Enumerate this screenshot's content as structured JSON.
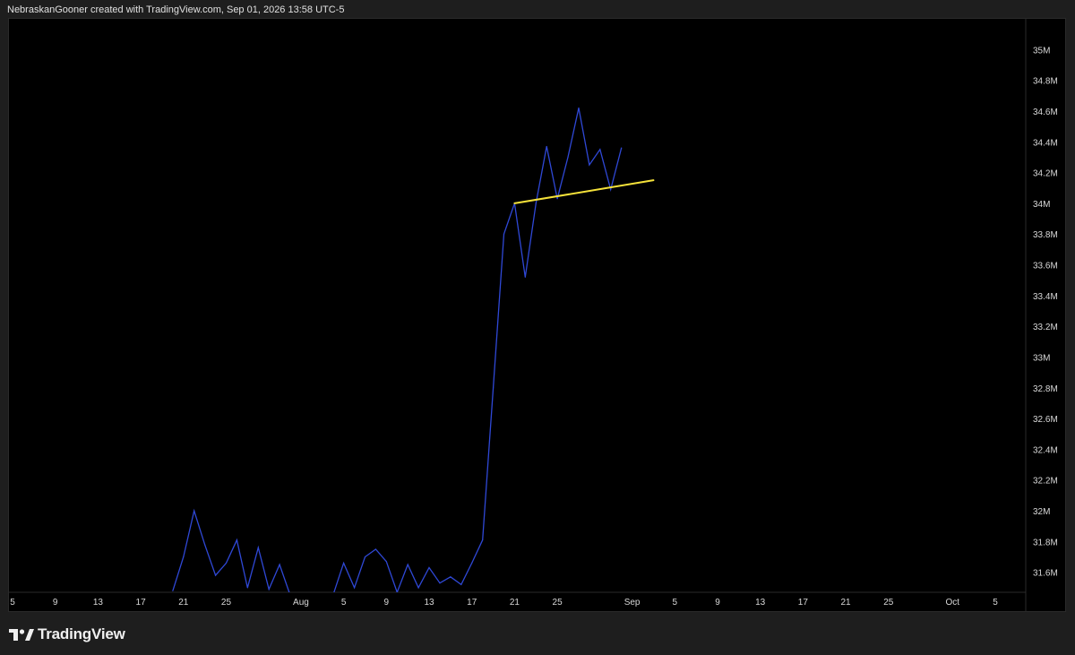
{
  "header": {
    "attribution": "NebraskanGooner created with TradingView.com, Sep 01, 2026 13:58 UTC-5"
  },
  "footer": {
    "brand_name": "TradingView",
    "brand_icon": "tradingview-logo-icon"
  },
  "colors": {
    "background": "#000000",
    "frame": "#1e1e1e",
    "series_line": "#2f48d6",
    "trendline": "#f5e23a",
    "axis_text": "#d8d8d8"
  },
  "chart_data": {
    "type": "line",
    "title": "",
    "xlabel": "",
    "ylabel": "",
    "grid": false,
    "y_axis_side": "right",
    "ylim": [
      31.47,
      35.2
    ],
    "y_ticks": [
      "35M",
      "34.8M",
      "34.6M",
      "34.4M",
      "34.2M",
      "34M",
      "33.8M",
      "33.6M",
      "33.4M",
      "33.2M",
      "33M",
      "32.8M",
      "32.6M",
      "32.4M",
      "32.2M",
      "32M",
      "31.8M",
      "31.6M"
    ],
    "y_tick_values": [
      35.0,
      34.8,
      34.6,
      34.4,
      34.2,
      34.0,
      33.8,
      33.6,
      33.4,
      33.2,
      33.0,
      32.8,
      32.6,
      32.4,
      32.2,
      32.0,
      31.8,
      31.6
    ],
    "x_range": [
      "2026-07-04",
      "2026-10-08"
    ],
    "x_ticks": [
      {
        "date": "2026-07-05",
        "label": "5"
      },
      {
        "date": "2026-07-09",
        "label": "9"
      },
      {
        "date": "2026-07-13",
        "label": "13"
      },
      {
        "date": "2026-07-17",
        "label": "17"
      },
      {
        "date": "2026-07-21",
        "label": "21"
      },
      {
        "date": "2026-07-25",
        "label": "25"
      },
      {
        "date": "2026-08-01",
        "label": "Aug"
      },
      {
        "date": "2026-08-05",
        "label": "5"
      },
      {
        "date": "2026-08-09",
        "label": "9"
      },
      {
        "date": "2026-08-13",
        "label": "13"
      },
      {
        "date": "2026-08-17",
        "label": "17"
      },
      {
        "date": "2026-08-21",
        "label": "21"
      },
      {
        "date": "2026-08-25",
        "label": "25"
      },
      {
        "date": "2026-09-01",
        "label": "Sep"
      },
      {
        "date": "2026-09-05",
        "label": "5"
      },
      {
        "date": "2026-09-09",
        "label": "9"
      },
      {
        "date": "2026-09-13",
        "label": "13"
      },
      {
        "date": "2026-09-17",
        "label": "17"
      },
      {
        "date": "2026-09-21",
        "label": "21"
      },
      {
        "date": "2026-09-25",
        "label": "25"
      },
      {
        "date": "2026-10-01",
        "label": "Oct"
      },
      {
        "date": "2026-10-05",
        "label": "5"
      }
    ],
    "series": [
      {
        "x": [
          "2026-07-20",
          "2026-07-21",
          "2026-07-22",
          "2026-07-23",
          "2026-07-24",
          "2026-07-25",
          "2026-07-26",
          "2026-07-27",
          "2026-07-28",
          "2026-07-29",
          "2026-07-30",
          "2026-07-31",
          "2026-08-01",
          "2026-08-02",
          "2026-08-03",
          "2026-08-04",
          "2026-08-05",
          "2026-08-06",
          "2026-08-07",
          "2026-08-08",
          "2026-08-09",
          "2026-08-10",
          "2026-08-11",
          "2026-08-12",
          "2026-08-13",
          "2026-08-14",
          "2026-08-15",
          "2026-08-16",
          "2026-08-17",
          "2026-08-18",
          "2026-08-19",
          "2026-08-20",
          "2026-08-21",
          "2026-08-22",
          "2026-08-23",
          "2026-08-24",
          "2026-08-25",
          "2026-08-26",
          "2026-08-27",
          "2026-08-28",
          "2026-08-29",
          "2026-08-30",
          "2026-08-31"
        ],
        "y": [
          31.48,
          31.7,
          32.0,
          31.78,
          31.58,
          31.66,
          31.81,
          31.5,
          31.76,
          31.49,
          31.65,
          31.45,
          31.45,
          31.45,
          31.45,
          31.45,
          31.66,
          31.5,
          31.7,
          31.75,
          31.67,
          31.47,
          31.65,
          31.5,
          31.63,
          31.53,
          31.57,
          31.52,
          31.66,
          31.81,
          32.8,
          33.8,
          34.0,
          33.52,
          34.0,
          34.37,
          34.03,
          34.3,
          34.62,
          34.25,
          34.35,
          34.09,
          34.36
        ]
      }
    ],
    "annotations": [
      {
        "type": "trendline",
        "from": {
          "x": "2026-08-21",
          "y": 34.0
        },
        "to": {
          "x": "2026-09-03",
          "y": 34.15
        }
      }
    ]
  }
}
